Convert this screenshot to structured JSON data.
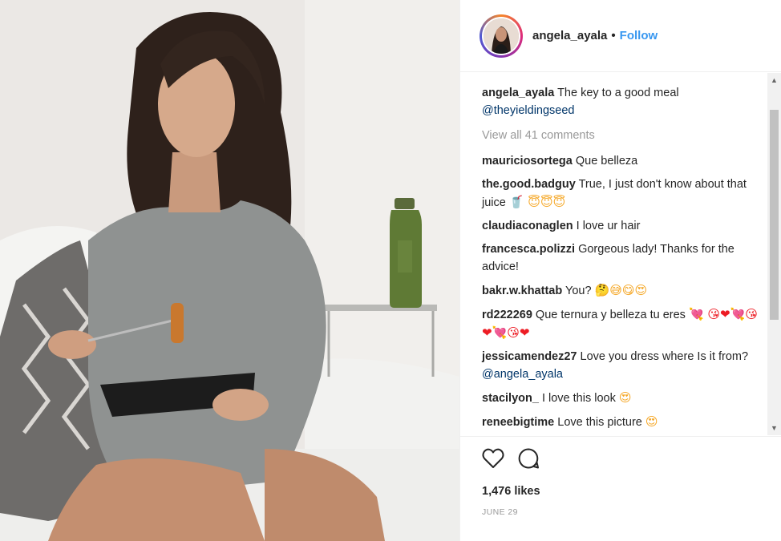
{
  "post": {
    "username": "angela_ayala",
    "follow_label": "Follow",
    "dot": "•",
    "caption_text": "The key to a good meal",
    "caption_mention": "@theyieldingseed",
    "view_all": "View all 41 comments",
    "comments": [
      {
        "user": "mauriciosortega",
        "text": "Que belleza",
        "emoji": ""
      },
      {
        "user": "the.good.badguy",
        "text": "True, I just don't know about that juice",
        "emoji": "🥤 😇😇😇"
      },
      {
        "user": "claudiaconaglen",
        "text": "I love ur hair",
        "emoji": ""
      },
      {
        "user": "francesca.polizzi",
        "text": "Gorgeous lady! Thanks for the advice!",
        "emoji": ""
      },
      {
        "user": "bakr.w.khattab",
        "text": "You?",
        "emoji": "🤔😅😋😍"
      },
      {
        "user": "rd222269",
        "text": "Que ternura y belleza tu eres",
        "emoji": "💘 😘❤💘😘❤💘😘❤"
      },
      {
        "user": "jessicamendez27",
        "text": "Love you dress where Is it from?",
        "mention": "@angela_ayala",
        "emoji": ""
      },
      {
        "user": "stacilyon_",
        "text": "I love this look",
        "emoji": "😍"
      },
      {
        "user": "reneebigtime",
        "text": "Love this picture",
        "emoji": "😍"
      }
    ],
    "likes": "1,476 likes",
    "date": "JUNE 29"
  },
  "icons": {
    "like": "heart-outline-icon",
    "comment": "comment-bubble-icon",
    "scroll_up": "▲",
    "scroll_down": "▼"
  },
  "colors": {
    "link": "#3897f0",
    "mention": "#003569",
    "muted": "#999999"
  }
}
